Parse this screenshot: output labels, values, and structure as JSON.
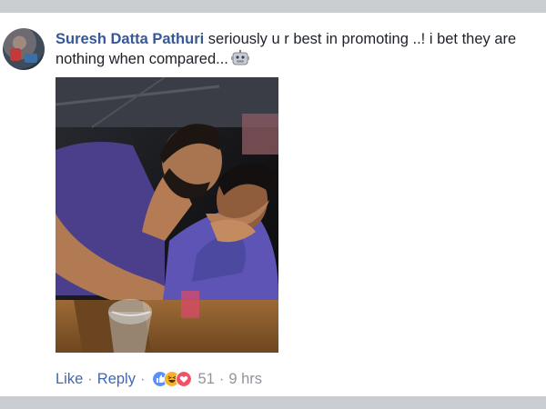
{
  "comment": {
    "author": "Suresh Datta Pathuri",
    "text": " seriously u r best in promoting ..! i bet they are nothing when compared...",
    "emoji": "robot-face-icon"
  },
  "actions": {
    "like_label": "Like",
    "reply_label": "Reply",
    "separator": "·",
    "reaction_icons": [
      "like-reaction-icon",
      "haha-reaction-icon",
      "love-reaction-icon"
    ],
    "reaction_count": "51",
    "time": "9 hrs"
  },
  "colors": {
    "author": "#365899",
    "link": "#4267b2",
    "meta": "#90949c",
    "like_reaction": "#5890ff",
    "haha_reaction": "#f7b125",
    "love_reaction": "#f25268"
  }
}
